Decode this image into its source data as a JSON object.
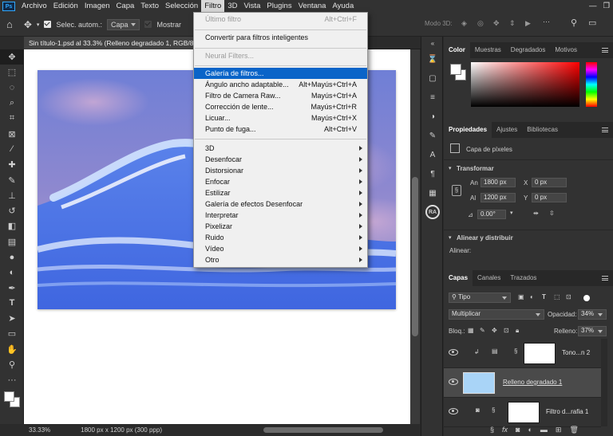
{
  "menubar": {
    "items": [
      "Archivo",
      "Edición",
      "Imagen",
      "Capa",
      "Texto",
      "Selección",
      "Filtro",
      "3D",
      "Vista",
      "Plugins",
      "Ventana",
      "Ayuda"
    ],
    "active": "Filtro"
  },
  "options": {
    "auto_select_label": "Selec. autom.:",
    "auto_select_value": "Capa",
    "show_label": "Mostrar",
    "mode_label": "Modo 3D:"
  },
  "document": {
    "tab_title": "Sin título-1.psd al 33.3% (Relleno degradado 1, RGB/8)",
    "zoom": "33.33%",
    "size_info": "1800 px x 1200 px (300 ppp)"
  },
  "filter_menu": {
    "items": [
      {
        "label": "Último filtro",
        "shortcut": "Alt+Ctrl+F",
        "disabled": true
      },
      {
        "label": "Convertir para filtros inteligentes",
        "shortcut": ""
      },
      {
        "label": "Neural Filters...",
        "shortcut": "",
        "disabled": true
      },
      {
        "label": "Galería de filtros...",
        "shortcut": "",
        "highlight": true
      },
      {
        "label": "Ángulo ancho adaptable...",
        "shortcut": "Alt+Mayús+Ctrl+A"
      },
      {
        "label": "Filtro de Camera Raw...",
        "shortcut": "Mayús+Ctrl+A"
      },
      {
        "label": "Corrección de lente...",
        "shortcut": "Mayús+Ctrl+R"
      },
      {
        "label": "Licuar...",
        "shortcut": "Mayús+Ctrl+X"
      },
      {
        "label": "Punto de fuga...",
        "shortcut": "Alt+Ctrl+V"
      },
      {
        "label": "3D",
        "submenu": true
      },
      {
        "label": "Desenfocar",
        "submenu": true
      },
      {
        "label": "Distorsionar",
        "submenu": true
      },
      {
        "label": "Enfocar",
        "submenu": true
      },
      {
        "label": "Estilizar",
        "submenu": true
      },
      {
        "label": "Galería de efectos Desenfocar",
        "submenu": true
      },
      {
        "label": "Interpretar",
        "submenu": true
      },
      {
        "label": "Pixelizar",
        "submenu": true
      },
      {
        "label": "Ruido",
        "submenu": true
      },
      {
        "label": "Vídeo",
        "submenu": true
      },
      {
        "label": "Otro",
        "submenu": true
      }
    ]
  },
  "color_panel": {
    "tabs": [
      "Color",
      "Muestras",
      "Degradados",
      "Motivos"
    ]
  },
  "properties_panel": {
    "tabs": [
      "Propiedades",
      "Ajustes",
      "Bibliotecas"
    ],
    "layer_kind": "Capa de píxeles",
    "transform_title": "Transformar",
    "width_label": "An",
    "width_value": "1800 px",
    "height_label": "Al",
    "height_value": "1200 px",
    "x_label": "X",
    "x_value": "0 px",
    "y_label": "Y",
    "y_value": "0 px",
    "angle_value": "0.00°",
    "align_title": "Alinear y distribuir",
    "align_label": "Alinear:"
  },
  "layers_panel": {
    "tabs": [
      "Capas",
      "Canales",
      "Trazados"
    ],
    "filter_kind": "Tipo",
    "blend_mode": "Multiplicar",
    "opacity_label": "Opacidad:",
    "opacity_value": "34%",
    "lock_label": "Bloq.:",
    "fill_label": "Relleno:",
    "fill_value": "37%",
    "layers": [
      {
        "name": "Tono...n 2",
        "thumb": "#ffffff"
      },
      {
        "name": "Relleno degradado 1",
        "thumb": "#a9d4f7",
        "selected": true
      },
      {
        "name": "Filtro d...rafia 1",
        "thumb": "#ffffff"
      }
    ]
  },
  "accent": "#0a64c8",
  "avatar_initials": "RA"
}
